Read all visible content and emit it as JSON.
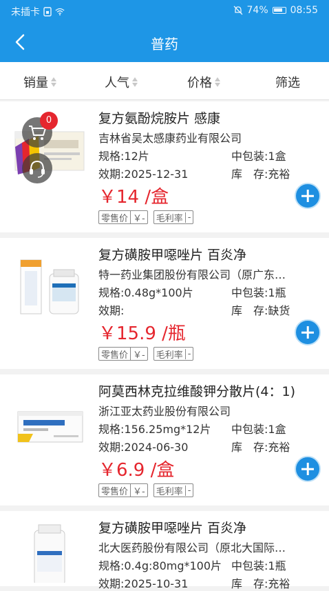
{
  "status": {
    "carrier": "未插卡",
    "battery": "74%",
    "time": "08:55"
  },
  "header": {
    "title": "普药"
  },
  "sort": [
    {
      "label": "销量"
    },
    {
      "label": "人气"
    },
    {
      "label": "价格"
    },
    {
      "label": "筛选"
    }
  ],
  "cart": {
    "count": "0"
  },
  "products": [
    {
      "name": "复方氨酚烷胺片 感康",
      "maker": "吉林省吴太感康药业有限公司",
      "spec": "规格:12片",
      "pack": "中包装:1盒",
      "expiry": "效期:2025-12-31",
      "stock": "库　存:充裕",
      "price": "￥14 /盒",
      "retail_label": "零售价",
      "retail_value": "￥-",
      "margin_label": "毛利率",
      "margin_value": "-"
    },
    {
      "name": "复方磺胺甲噁唑片 百炎净",
      "maker": "特一药业集团股份有限公司（原广东…",
      "spec": "规格:0.48g*100片",
      "pack": "中包装:1瓶",
      "expiry": "效期:",
      "stock": "库　存:缺货",
      "price": "￥15.9 /瓶",
      "retail_label": "零售价",
      "retail_value": "￥-",
      "margin_label": "毛利率",
      "margin_value": "-"
    },
    {
      "name": "阿莫西林克拉维酸钾分散片(4：1)",
      "maker": "浙江亚太药业股份有限公司",
      "spec": "规格:156.25mg*12片",
      "pack": "中包装:1盒",
      "expiry": "效期:2024-06-30",
      "stock": "库　存:充裕",
      "price": "￥6.9 /盒",
      "retail_label": "零售价",
      "retail_value": "￥-",
      "margin_label": "毛利率",
      "margin_value": "-"
    },
    {
      "name": "复方磺胺甲噁唑片 百炎净",
      "maker": "北大医药股份有限公司（原北大国际…",
      "spec": "规格:0.4g:80mg*100片",
      "pack": "中包装:1瓶",
      "expiry": "效期:2025-10-31",
      "stock": "库　存:充裕"
    }
  ]
}
